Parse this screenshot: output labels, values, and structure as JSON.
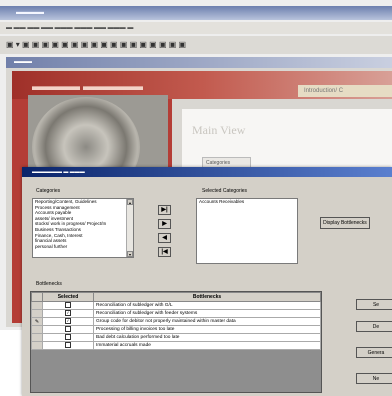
{
  "dialog": {
    "categories_label": "Categories",
    "selected_categories_label": "Selected Categories",
    "bottlenecks_label": "Bottlenecks",
    "categories": [
      "Reporting/Content, Guidelines",
      "Process management",
      "Accounts payable",
      "assets/ investment",
      "stocks/ work in progress/ Project/In",
      "Business Transactions",
      "Finance, Cash, Interest",
      "financial assets",
      "personal further"
    ],
    "selected_categories": [
      "Accounts Receivables"
    ],
    "move_buttons": [
      "▶|",
      "▶",
      "◀",
      "|◀"
    ],
    "display_button": "Display Bottlenecks",
    "right_buttons": [
      "Se",
      "De",
      "Genera",
      "Ne"
    ],
    "table": {
      "headers": [
        "Selected",
        "Bottlenecks"
      ],
      "rows": [
        {
          "checked": false,
          "text": "Reconciliation of subledger with G/L",
          "current": false
        },
        {
          "checked": true,
          "text": "Reconciliation of subledger with feeder systems",
          "current": false
        },
        {
          "checked": true,
          "text": "Group code for debitor not properly maintained within master data",
          "current": true
        },
        {
          "checked": false,
          "text": "Processing of billing invoices too late",
          "current": false
        },
        {
          "checked": false,
          "text": "Bad debt calculation performed too late",
          "current": false
        },
        {
          "checked": false,
          "text": "Immaterial accruals made",
          "current": false
        }
      ]
    }
  },
  "background": {
    "tab_label": "Introduction/ C",
    "view_title": "Main View",
    "category_button": "Categories"
  }
}
